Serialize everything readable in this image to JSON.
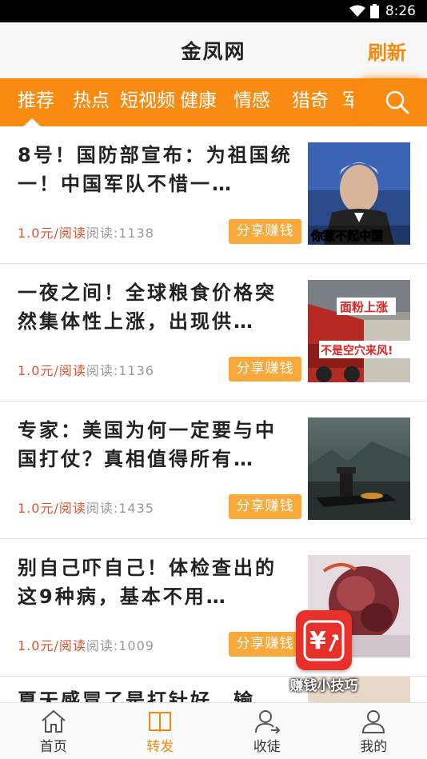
{
  "status": {
    "time": "8:26"
  },
  "header": {
    "title": "金凤网",
    "refresh_label": "刷新"
  },
  "tabs": [
    {
      "label": "推荐",
      "active": true
    },
    {
      "label": "热点"
    },
    {
      "label": "短视频"
    },
    {
      "label": "健康"
    },
    {
      "label": "情感"
    },
    {
      "label": "猎奇"
    },
    {
      "label": "军"
    }
  ],
  "articles": [
    {
      "title": "8号！国防部宣布：为祖国统一！中国军队不惜一…",
      "price": "1.0元/阅读",
      "reads": "阅读:1138",
      "share": "分享赚钱",
      "thumb_caption": "你惹不起中国"
    },
    {
      "title": "一夜之间！全球粮食价格突然集体性上涨，出现供…",
      "price": "1.0元/阅读",
      "reads": "阅读:1136",
      "share": "分享赚钱",
      "thumb_caption_1": "面粉上涨",
      "thumb_caption_2": "不是空穴来风!"
    },
    {
      "title": "专家：美国为何一定要与中国打仗？真相值得所有…",
      "price": "1.0元/阅读",
      "reads": "阅读:1435",
      "share": "分享赚钱"
    },
    {
      "title": "别自己吓自己！体检查出的这9种病，基本不用…",
      "price": "1.0元/阅读",
      "reads": "阅读:1009",
      "share": "分享赚钱"
    },
    {
      "title": "夏天感冒了是打针好，输"
    }
  ],
  "floating": {
    "label": "赚钱小技巧",
    "icon_text": "¥"
  },
  "bottom_nav": [
    {
      "label": "首页",
      "icon": "home-icon"
    },
    {
      "label": "转发",
      "icon": "book-icon",
      "active": true
    },
    {
      "label": "收徒",
      "icon": "add-user-icon"
    },
    {
      "label": "我的",
      "icon": "profile-icon"
    }
  ],
  "colors": {
    "accent": "#f98b12",
    "price": "#e0502c",
    "share_button": "#f9a83a",
    "floating_badge": "#e8302a"
  }
}
